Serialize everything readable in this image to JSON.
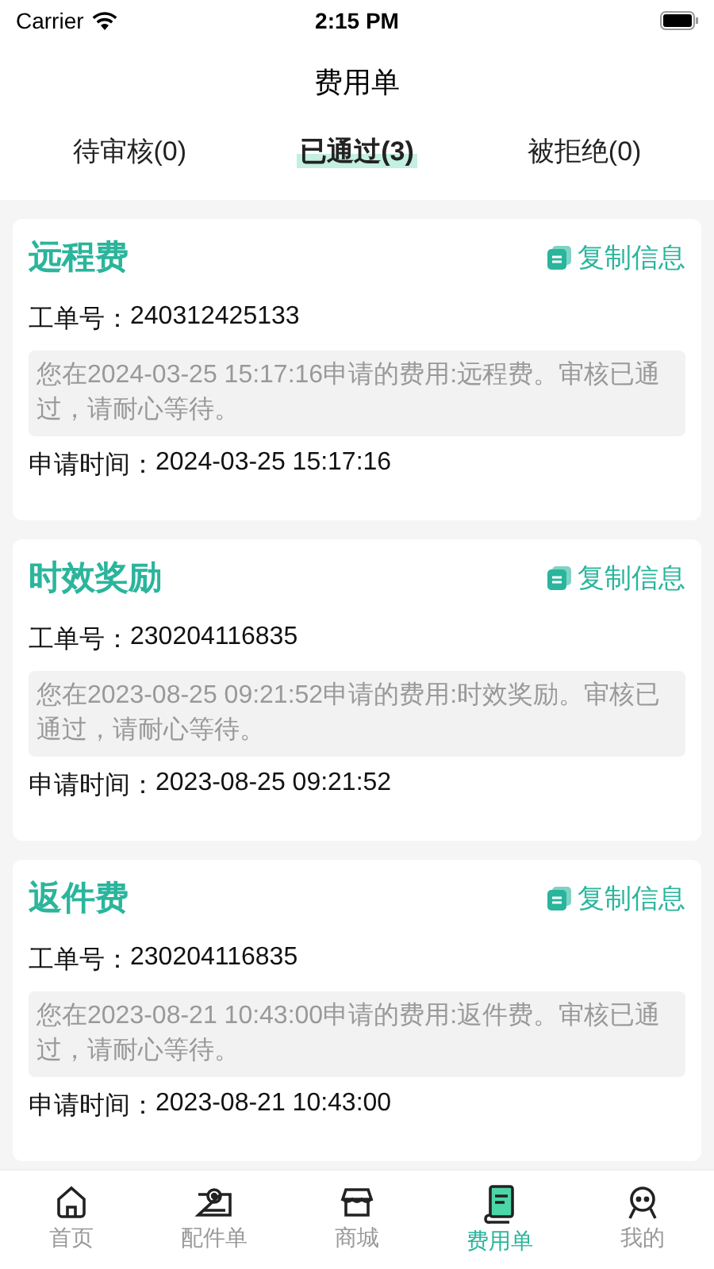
{
  "status_bar": {
    "carrier": "Carrier",
    "time": "2:15 PM"
  },
  "title": "费用单",
  "tabs": [
    {
      "label": "待审核(0)",
      "selected": false
    },
    {
      "label": "已通过(3)",
      "selected": true
    },
    {
      "label": "被拒绝(0)",
      "selected": false
    }
  ],
  "cards": [
    {
      "title": "远程费",
      "copy_label": "复制信息",
      "order_label": "工单号：",
      "order_no": "240312425133",
      "notice": "您在2024-03-25 15:17:16申请的费用:远程费。审核已通过，请耐心等待。",
      "time_label": "申请时间：",
      "time": "2024-03-25 15:17:16"
    },
    {
      "title": "时效奖励",
      "copy_label": "复制信息",
      "order_label": "工单号：",
      "order_no": "230204116835",
      "notice": "您在2023-08-25 09:21:52申请的费用:时效奖励。审核已通过，请耐心等待。",
      "time_label": "申请时间：",
      "time": "2023-08-25 09:21:52"
    },
    {
      "title": "返件费",
      "copy_label": "复制信息",
      "order_label": "工单号：",
      "order_no": "230204116835",
      "notice": "您在2023-08-21 10:43:00申请的费用:返件费。审核已通过，请耐心等待。",
      "time_label": "申请时间：",
      "time": "2023-08-21 10:43:00"
    }
  ],
  "tab_bar": [
    {
      "label": "首页",
      "kind": "home",
      "selected": false
    },
    {
      "label": "配件单",
      "kind": "parts",
      "selected": false
    },
    {
      "label": "商城",
      "kind": "shop",
      "selected": false
    },
    {
      "label": "费用单",
      "kind": "bill",
      "selected": true
    },
    {
      "label": "我的",
      "kind": "user",
      "selected": false
    }
  ]
}
